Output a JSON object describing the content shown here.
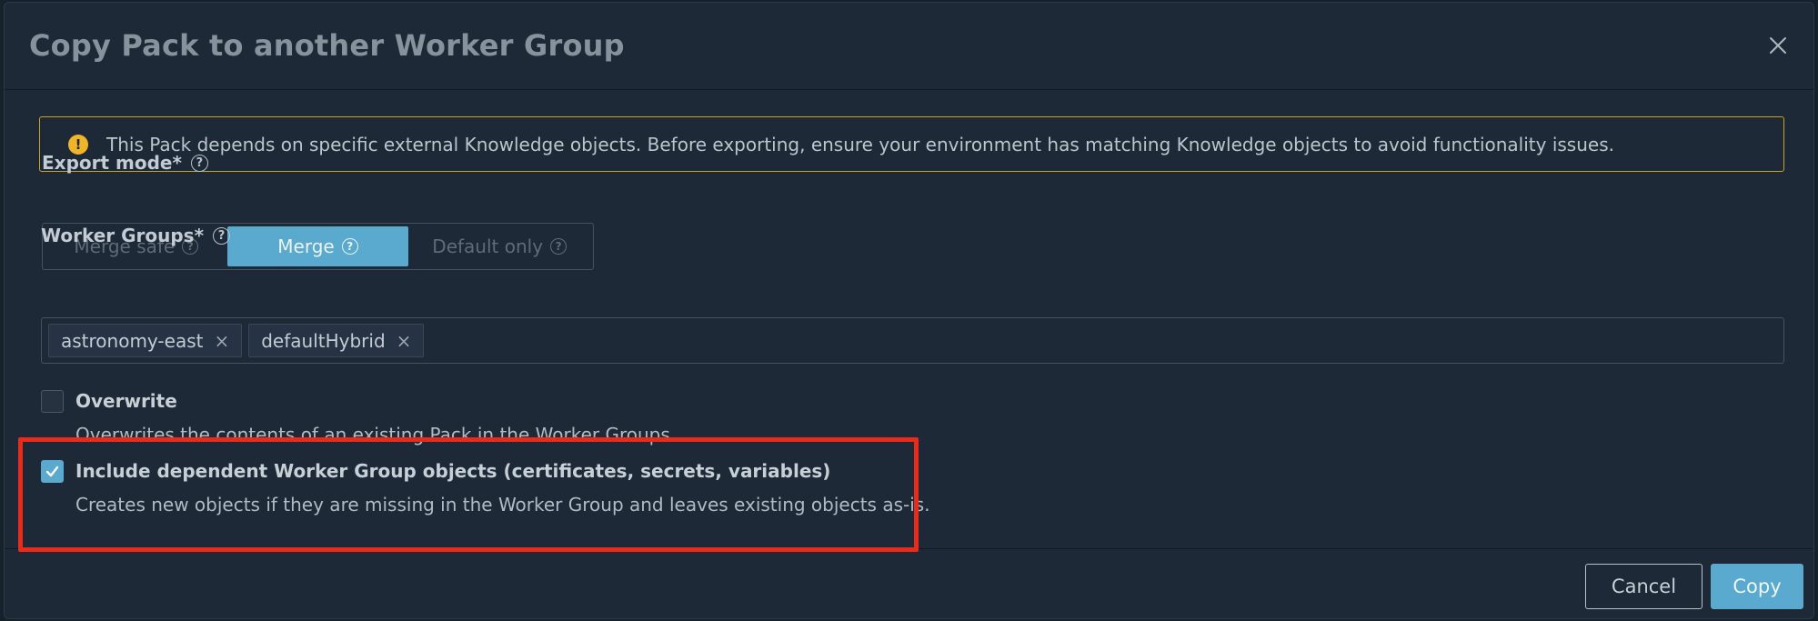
{
  "dialog": {
    "title": "Copy Pack to another Worker Group",
    "close_icon": "close-icon"
  },
  "warning": {
    "icon": "warning-icon",
    "icon_glyph": "!",
    "text": "This Pack depends on specific external Knowledge objects. Before exporting, ensure your environment has matching Knowledge objects to avoid functionality issues."
  },
  "export_mode": {
    "label": "Export mode*",
    "help_glyph": "?",
    "options": [
      {
        "label": "Merge safe",
        "selected": false
      },
      {
        "label": "Merge",
        "selected": true
      },
      {
        "label": "Default only",
        "selected": false
      }
    ]
  },
  "worker_groups": {
    "label": "Worker Groups*",
    "help_glyph": "?",
    "tags": [
      "astronomy-east",
      "defaultHybrid"
    ],
    "remove_glyph": "×"
  },
  "overwrite": {
    "title": "Overwrite",
    "description": "Overwrites the contents of an existing Pack in the Worker Groups.",
    "checked": false
  },
  "include_dependent": {
    "title": "Include dependent Worker Group objects (certificates, secrets, variables)",
    "description": "Creates new objects if they are missing in the Worker Group and leaves existing objects as-is.",
    "checked": true
  },
  "footer": {
    "cancel_label": "Cancel",
    "copy_label": "Copy"
  },
  "colors": {
    "accent": "#5aa9cf",
    "warning_border": "#c9a226",
    "warning_icon": "#f0b429",
    "highlight": "#ea2a1a",
    "background": "#1d2936"
  }
}
